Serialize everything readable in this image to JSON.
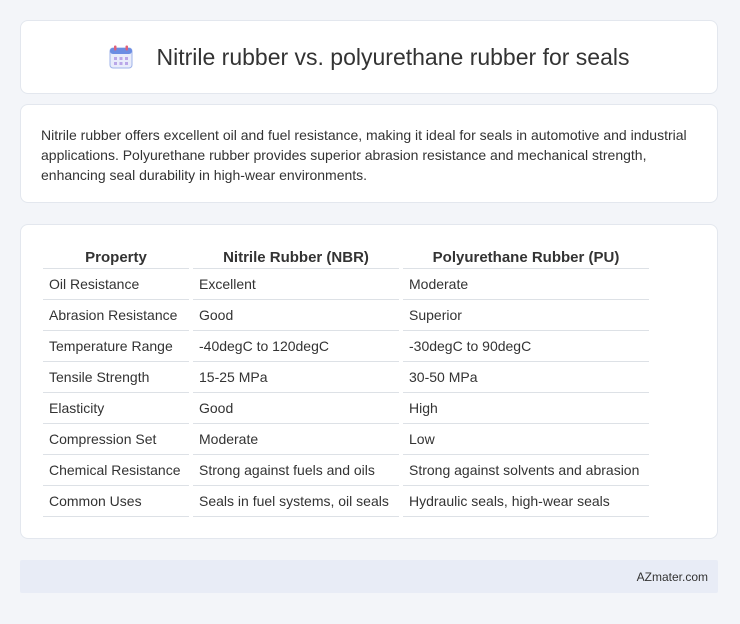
{
  "header": {
    "title": "Nitrile rubber vs. polyurethane rubber for seals",
    "icon": "calendar-icon"
  },
  "description": "Nitrile rubber offers excellent oil and fuel resistance, making it ideal for seals in automotive and industrial applications. Polyurethane rubber provides superior abrasion resistance and mechanical strength, enhancing seal durability in high-wear environments.",
  "table": {
    "headers": [
      "Property",
      "Nitrile Rubber (NBR)",
      "Polyurethane Rubber (PU)"
    ],
    "rows": [
      [
        "Oil Resistance",
        "Excellent",
        "Moderate"
      ],
      [
        "Abrasion Resistance",
        "Good",
        "Superior"
      ],
      [
        "Temperature Range",
        "-40degC to 120degC",
        "-30degC to 90degC"
      ],
      [
        "Tensile Strength",
        "15-25 MPa",
        "30-50 MPa"
      ],
      [
        "Elasticity",
        "Good",
        "High"
      ],
      [
        "Compression Set",
        "Moderate",
        "Low"
      ],
      [
        "Chemical Resistance",
        "Strong against fuels and oils",
        "Strong against solvents and abrasion"
      ],
      [
        "Common Uses",
        "Seals in fuel systems, oil seals",
        "Hydraulic seals, high-wear seals"
      ]
    ]
  },
  "footer": {
    "site": "AZmater.com"
  },
  "colors": {
    "background": "#f3f5f9",
    "footer_bg": "#e8ecf6",
    "icon_accent": "#6b8de3"
  }
}
